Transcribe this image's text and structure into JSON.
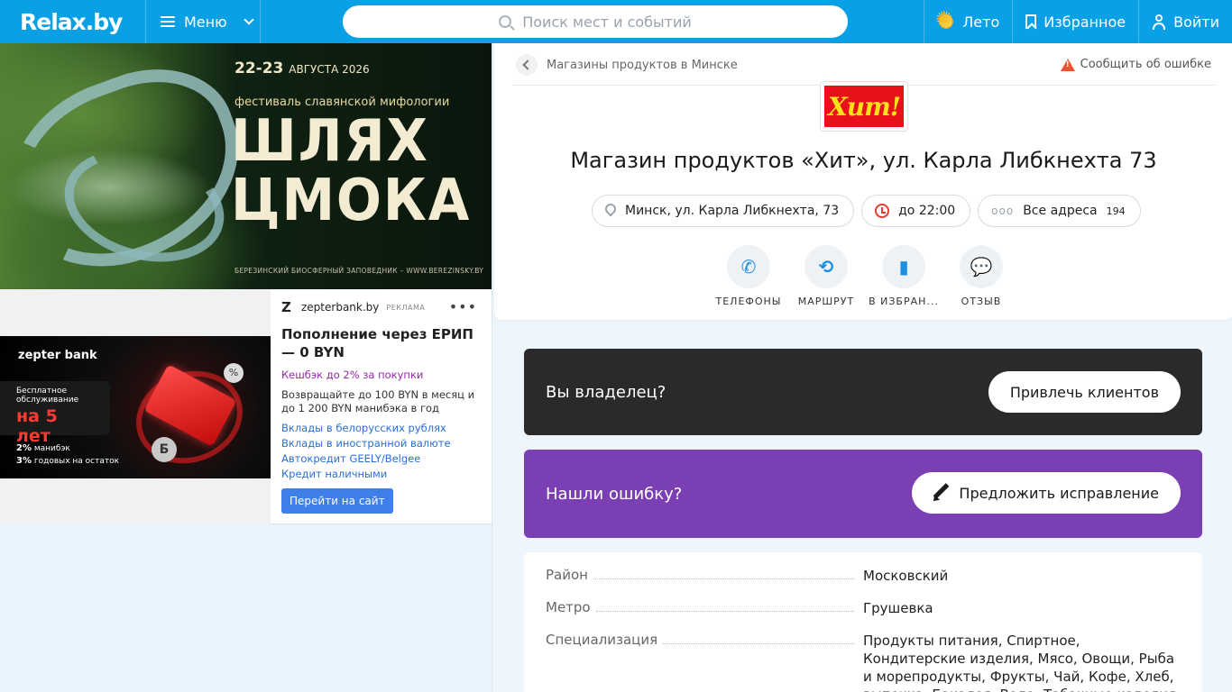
{
  "header": {
    "logo": "Relax.by",
    "menu_label": "Меню",
    "search_placeholder": "Поиск мест и событий",
    "season_label": "Лето",
    "favorites_label": "Избранное",
    "login_label": "Войти",
    "color": "#0aa0e6"
  },
  "banner": {
    "date": "22-23",
    "month": "АВГУСТА 2026",
    "subtitle": "фестиваль славянской мифологии",
    "title_line1": "ШЛЯХ",
    "title_line2": "ЦМОКА",
    "footer": "БЕРЕЗИНСКИЙ БИОСФЕРНЫЙ ЗАПОВЕДНИК – WWW.BEREZINSKY.BY"
  },
  "ad": {
    "brand_image": "zepter bank",
    "badge_text": "Бесплатное обслуживание",
    "badge_big": "на 5 лет",
    "perk1_big": "2%",
    "perk1": "манибэк",
    "perk2_big": "3%",
    "perk2": "годовых на остаток",
    "source": "zepterbank.by",
    "source_tag": "РЕКЛАМА",
    "headline": "Пополнение через ЕРИП — 0 BYN",
    "cashback": "Кешбэк до 2% за покупки",
    "description": "Возвращайте до 100 BYN в месяц и до 1 200 BYN манибэка в год",
    "links": [
      "Вклады в белорусских рублях",
      "Вклады в иностранной валюте",
      "Автокредит GEELY/Belgee",
      "Кредит наличными"
    ],
    "cta": "Перейти на сайт"
  },
  "place": {
    "breadcrumb": "Магазины продуктов в Минске",
    "report_label": "Сообщить об ошибке",
    "logo_text": "Хит!",
    "title": "Магазин продуктов «Хит», ул. Карла Либкнехта 73",
    "address": "Минск, ул. Карла Либкнехта, 73",
    "hours": "до 22:00",
    "all_addresses": "Все адреса",
    "all_addresses_count": "194",
    "actions": [
      {
        "label": "ТЕЛЕФОНЫ",
        "icon": "phone-icon"
      },
      {
        "label": "МАРШРУТ",
        "icon": "route-icon"
      },
      {
        "label": "В ИЗБРАН...",
        "icon": "bookmark-icon"
      },
      {
        "label": "ОТЗЫВ",
        "icon": "comment-icon"
      }
    ]
  },
  "owner": {
    "label": "Вы владелец?",
    "button": "Привлечь клиентов"
  },
  "error_block": {
    "label": "Нашли ошибку?",
    "button": "Предложить исправление"
  },
  "details": [
    {
      "key": "Район",
      "value": "Московский"
    },
    {
      "key": "Метро",
      "value": "Грушевка"
    },
    {
      "key": "Специализация",
      "value": "Продукты питания, Спиртное, Кондитерские изделия, Мясо, Овощи, Рыба и морепродукты, Фрукты, Чай, Кофе, Хлеб, выпечка, Бакалея, Вода, Табачные изделия"
    }
  ]
}
